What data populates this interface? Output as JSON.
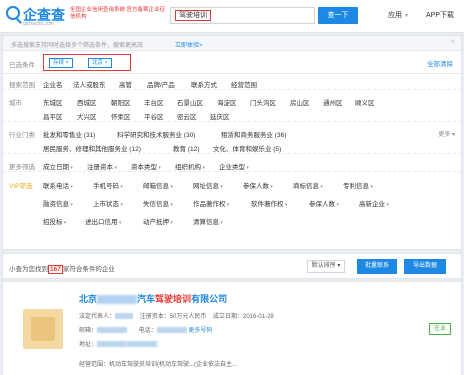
{
  "header": {
    "logo_text": "企查查",
    "logo_sub": "qichacha.com",
    "tagline": "全国企业信用查询系统 官方备案企业征信机构",
    "search_value": "驾驶培训",
    "search_button": "查一下",
    "nav_app": "应用",
    "nav_download": "APP下载"
  },
  "tip": {
    "text": "多选搜索支持同时选择多个筛选条件，搜索更高效",
    "link": "立即体验>",
    "close": "×"
  },
  "selected": {
    "label": "已选条件",
    "chips": [
      "存续 ×",
      "北京 ×"
    ],
    "clear_all": "全部清除"
  },
  "filters": {
    "scope": {
      "label": "搜索范围",
      "options": [
        "企业名",
        "法人或股东",
        "高管",
        "品牌/产品",
        "联系方式",
        "经营范围"
      ]
    },
    "city": {
      "label": "城市",
      "row1": [
        "东城区",
        "西城区",
        "朝阳区",
        "丰台区",
        "石景山区",
        "海淀区",
        "门头沟区",
        "房山区",
        "通州区",
        "顺义区"
      ],
      "row2": [
        "昌平区",
        "大兴区",
        "怀柔区",
        "平谷区",
        "密云区",
        "延庆区"
      ]
    },
    "industry": {
      "label": "行业门类",
      "row1": [
        "批发和零售业 (31)",
        "科学研究和技术服务业 (30)",
        "租赁和商务服务业 (36)"
      ],
      "row2": [
        "居民服务、修理和其他服务业 (12)",
        "教育 (12)",
        "文化、体育和娱乐业 (5)"
      ],
      "more": "更多 ▾"
    },
    "more_filters": {
      "label": "更多筛选",
      "options": [
        "成立日期",
        "注册资本",
        "资本类型",
        "组织机构",
        "企业类型"
      ]
    },
    "vip": {
      "label": "VIP筛选",
      "row1": [
        "联系电话",
        "手机号码",
        "邮箱信息",
        "网址信息",
        "参保人数",
        "商标信息",
        "专利信息"
      ],
      "row2": [
        "融资信息",
        "上市状态",
        "失信信息",
        "作品著作权",
        "软件著作权",
        "参保人数",
        "高新企业"
      ],
      "row3": [
        "招投标",
        "进出口信用",
        "动产抵押",
        "清算信息"
      ]
    }
  },
  "results": {
    "prefix": "小查为您找到",
    "count": "167",
    "suffix": "家符合条件的企业",
    "sort_button": "默认排序 ▾",
    "bulk_button": "批量联系",
    "export_button": "导出数据"
  },
  "company": {
    "name_prefix": "北京",
    "name_mid": "汽车",
    "name_hl1": "驾驶",
    "name_hl2": "培训",
    "name_suffix": "有限公司",
    "legal_label": "法定代表人：",
    "capital": "注册资本：50万元人民币",
    "founded": "成立日期：2016-01-28",
    "phone_label": "电话：",
    "email_label": "邮箱：",
    "more_numbers": "更多号码",
    "address_label": "地址：",
    "scope_text": "经营范围：机动车驾驶员培训(机动车驾驶...(企业依法自主...",
    "status": "在业"
  },
  "colors": {
    "brand_blue": "#1e88e5",
    "highlight_red": "#e53935",
    "vip_orange": "#f5a623",
    "status_green": "#4caf50"
  }
}
